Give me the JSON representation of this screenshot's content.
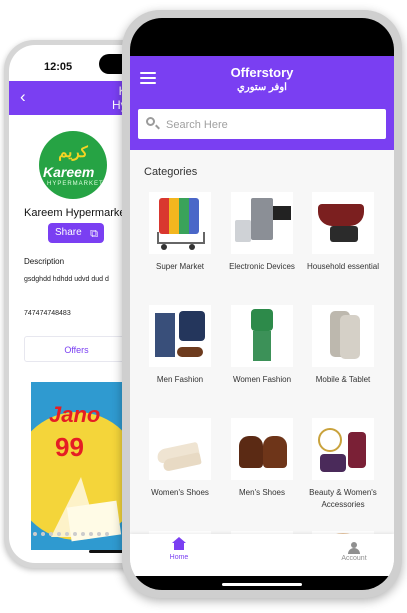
{
  "store_screen": {
    "time": "12:05",
    "back_icon": "back-arrow-icon",
    "title": "Kareem Hypermarket",
    "title_short": "Kar\nHyper",
    "logo_ar": "كريم",
    "logo_en": "Kareem",
    "logo_sub": "HYPERMARKET",
    "store_name": "Kareem Hypermarket",
    "share_label": "Share",
    "description_label": "Description",
    "description_text": "gsdghdd hdhdd udvd dud d",
    "phone": "747474748483",
    "offers_tab": "Offers",
    "promo_line1": "Jano",
    "promo_line2": "99"
  },
  "main_screen": {
    "app_title": "Offerstory",
    "app_subtitle": "اوفر ستوري",
    "search": {
      "placeholder": "Search Here"
    },
    "categories_heading": "Categories",
    "categories": [
      {
        "label": "Super Market"
      },
      {
        "label": "Electronic Devices"
      },
      {
        "label": "Household essential"
      },
      {
        "label": "Men Fashion"
      },
      {
        "label": "Women Fashion"
      },
      {
        "label": "Mobile & Tablet"
      },
      {
        "label": "Women's Shoes"
      },
      {
        "label": "Men's Shoes"
      },
      {
        "label": "Beauty & Women's Accessories"
      },
      {
        "label": ""
      },
      {
        "label": ""
      },
      {
        "label": ""
      }
    ],
    "nav": {
      "home_label": "Home",
      "account_label": "Account"
    }
  },
  "colors": {
    "accent": "#7a3ff2",
    "nav_inactive": "#8f8f8f"
  }
}
